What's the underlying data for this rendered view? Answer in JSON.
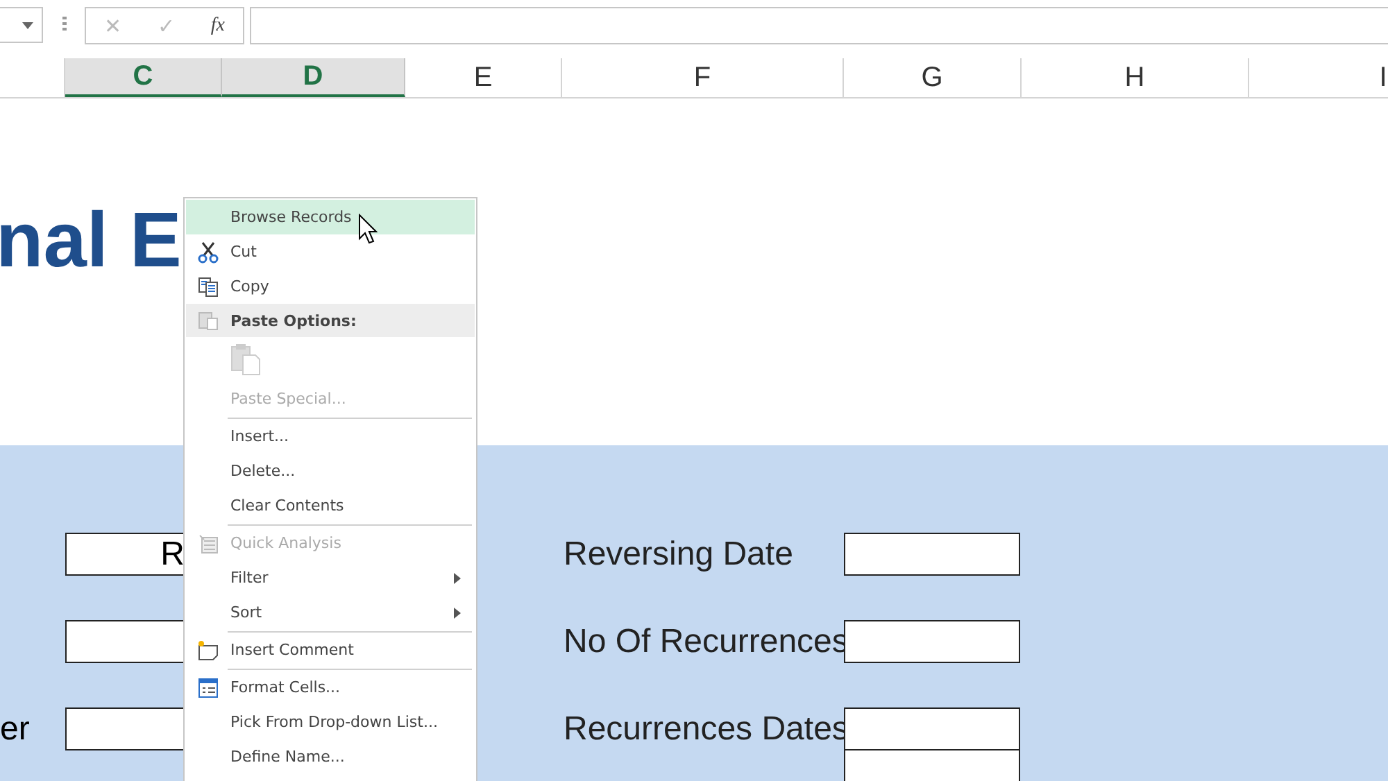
{
  "formula_bar": {
    "buttons": [
      "✕",
      "✓",
      "fx"
    ]
  },
  "columns": [
    {
      "label": "C",
      "selected": true
    },
    {
      "label": "D",
      "selected": true
    },
    {
      "label": "E",
      "selected": false
    },
    {
      "label": "F",
      "selected": false
    },
    {
      "label": "G",
      "selected": false
    },
    {
      "label": "H",
      "selected": false
    },
    {
      "label": "I",
      "selected": false
    }
  ],
  "title": "nal E",
  "form": {
    "rows": [
      {
        "left_label": null,
        "left_value": "R",
        "right_label": "Reversing Date"
      },
      {
        "left_label": null,
        "left_value": null,
        "right_label": "No Of Recurrences"
      },
      {
        "left_label": "er",
        "left_value": null,
        "right_label": "Recurrences Dates"
      }
    ]
  },
  "context_menu": {
    "items": [
      {
        "kind": "item",
        "label": "Browse Records",
        "selected": true,
        "disabled": false,
        "submenu": false,
        "separator_after": false
      },
      {
        "kind": "item",
        "label": "Cut",
        "selected": false,
        "disabled": false,
        "submenu": false,
        "separator_after": false
      },
      {
        "kind": "item",
        "label": "Copy",
        "selected": false,
        "disabled": false,
        "submenu": false,
        "separator_after": false
      },
      {
        "kind": "header",
        "label": "Paste Options:",
        "disabled": false,
        "submenu": false,
        "separator_after": false
      },
      {
        "kind": "paste-buttons",
        "selected": false,
        "disabled": true,
        "submenu": false,
        "separator_after": false
      },
      {
        "kind": "item",
        "label": "Paste Special...",
        "selected": false,
        "disabled": true,
        "submenu": false,
        "separator_after": true
      },
      {
        "kind": "item",
        "label": "Insert...",
        "selected": false,
        "disabled": false,
        "submenu": false,
        "separator_after": false
      },
      {
        "kind": "item",
        "label": "Delete...",
        "selected": false,
        "disabled": false,
        "submenu": false,
        "separator_after": false
      },
      {
        "kind": "item",
        "label": "Clear Contents",
        "selected": false,
        "disabled": false,
        "submenu": false,
        "separator_after": true
      },
      {
        "kind": "item",
        "label": "Quick Analysis",
        "selected": false,
        "disabled": true,
        "submenu": false,
        "separator_after": false
      },
      {
        "kind": "item",
        "label": "Filter",
        "selected": false,
        "disabled": false,
        "submenu": true,
        "separator_after": false
      },
      {
        "kind": "item",
        "label": "Sort",
        "selected": false,
        "disabled": false,
        "submenu": true,
        "separator_after": true
      },
      {
        "kind": "item",
        "label": "Insert Comment",
        "selected": false,
        "disabled": false,
        "submenu": false,
        "separator_after": true
      },
      {
        "kind": "item",
        "label": "Format Cells...",
        "selected": false,
        "disabled": false,
        "submenu": false,
        "separator_after": false
      },
      {
        "kind": "item",
        "label": "Pick From Drop-down List...",
        "selected": false,
        "disabled": false,
        "submenu": false,
        "separator_after": false
      },
      {
        "kind": "item",
        "label": "Define Name...",
        "selected": false,
        "disabled": false,
        "submenu": false,
        "separator_after": false
      }
    ]
  }
}
